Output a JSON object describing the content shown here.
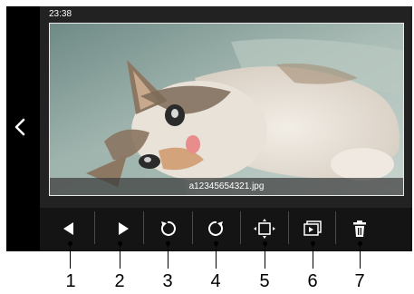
{
  "status": {
    "time": "23:38"
  },
  "photo": {
    "filename": "a12345654321.jpg"
  },
  "toolbar": {
    "buttons": [
      {
        "callout": "1",
        "icon": "previous-triangle-icon"
      },
      {
        "callout": "2",
        "icon": "next-triangle-icon"
      },
      {
        "callout": "3",
        "icon": "rotate-left-icon"
      },
      {
        "callout": "4",
        "icon": "rotate-right-icon"
      },
      {
        "callout": "5",
        "icon": "zoom-fit-icon"
      },
      {
        "callout": "6",
        "icon": "slideshow-icon"
      },
      {
        "callout": "7",
        "icon": "trash-icon"
      }
    ]
  },
  "colors": {
    "screen_bg": "#222222",
    "toolbar_bg": "#141414",
    "icon": "#ffffff"
  }
}
